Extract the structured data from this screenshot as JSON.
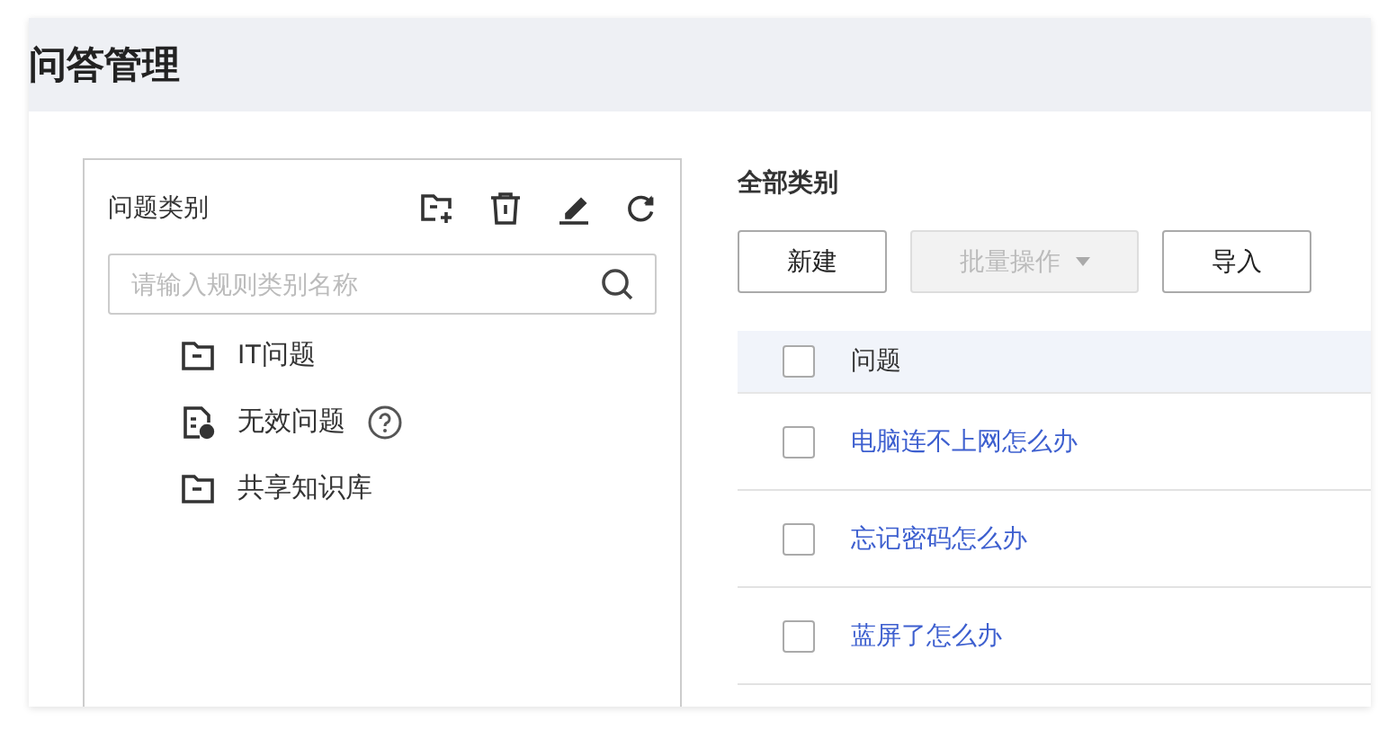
{
  "page": {
    "title": "问答管理"
  },
  "category_panel": {
    "title": "问题类别",
    "search": {
      "placeholder": "请输入规则类别名称"
    },
    "tree": [
      {
        "kind": "folder",
        "label": "IT问题",
        "help": false
      },
      {
        "kind": "invalid",
        "label": "无效问题",
        "help": true
      },
      {
        "kind": "folder",
        "label": "共享知识库",
        "help": false
      }
    ]
  },
  "main": {
    "title": "全部类别",
    "buttons": [
      {
        "label": "新建",
        "disabled": false,
        "dropdown": false
      },
      {
        "label": "批量操作",
        "disabled": true,
        "dropdown": true
      },
      {
        "label": "导入",
        "disabled": false,
        "dropdown": false
      }
    ],
    "table": {
      "header": {
        "label": "问题",
        "checked": false
      },
      "rows": [
        {
          "question": "电脑连不上网怎么办",
          "checked": false
        },
        {
          "question": "忘记密码怎么办",
          "checked": false
        },
        {
          "question": "蓝屏了怎么办",
          "checked": false
        }
      ]
    }
  }
}
